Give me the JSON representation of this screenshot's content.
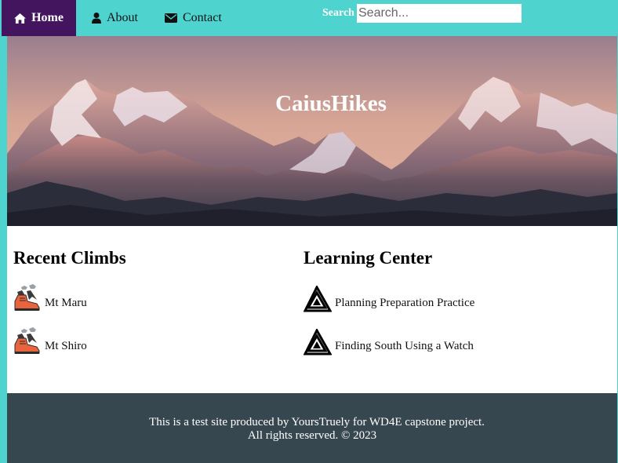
{
  "nav": {
    "items": [
      {
        "label": "Home",
        "icon": "home-icon"
      },
      {
        "label": "About",
        "icon": "user-icon"
      },
      {
        "label": "Contact",
        "icon": "envelope-icon"
      }
    ],
    "search_label": "Search",
    "search_placeholder": "Search..."
  },
  "hero": {
    "title": "CaiusHikes"
  },
  "recent_climbs": {
    "title": "Recent Climbs",
    "items": [
      {
        "label": "Mt Maru",
        "icon": "hiking-boot-icon"
      },
      {
        "label": "Mt Shiro",
        "icon": "hiking-boot-icon"
      }
    ]
  },
  "learning_center": {
    "title": "Learning Center",
    "items": [
      {
        "label": "Planning Preparation Practice",
        "icon": "triangle-logo-icon"
      },
      {
        "label": "Finding South Using a Watch",
        "icon": "triangle-logo-icon"
      }
    ]
  },
  "footer": {
    "line1": "This is a test site produced by YoursTruely for WD4E capstone project.",
    "line2": "All rights reserved. © 2023"
  },
  "colors": {
    "nav_bg": "#4ed3cf",
    "nav_active": "#43155f",
    "footer_bg": "#37474f"
  }
}
